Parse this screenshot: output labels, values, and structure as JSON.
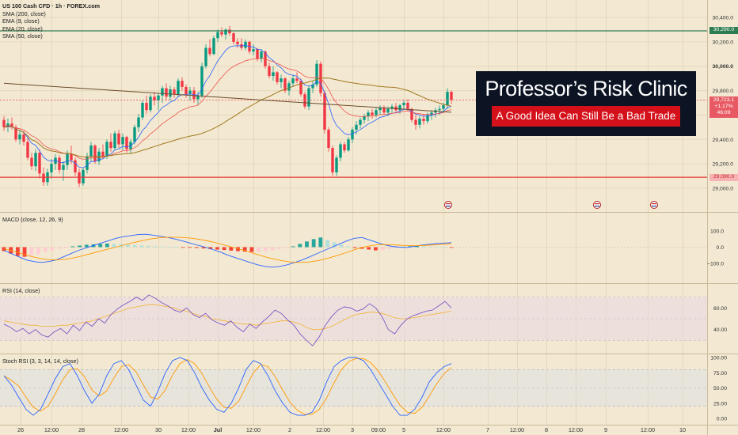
{
  "legend": {
    "title": "US 100 Cash CFD · 1h · FOREX.com",
    "sma200": "SMA (200, close)",
    "ema9": "EMA (9, close)",
    "ema20": "EMA (20, close)",
    "sma50": "SMA (50, close)"
  },
  "panes": {
    "macd_label": "MACD (close, 12, 26, 9)",
    "rsi_label": "RSI (14, close)",
    "stoch_label": "Stoch RSI (3, 3, 14, 14, close)"
  },
  "banner": {
    "title": "Professor’s Risk Clinic",
    "subtitle": "A Good Idea Can Still Be a Bad Trade"
  },
  "badges": {
    "resistance": "30,290.0",
    "price": "29,723.1",
    "change": "+1.17%",
    "countdown": "46:09",
    "support": "29,090.0"
  },
  "colors": {
    "background": "#f3e9d2",
    "up": "#089981",
    "down": "#f23645",
    "ema9": "#2962ff",
    "ema20": "#ef5350",
    "sma50": "#a0781e",
    "sma200": "#6d4c2b",
    "resistance": "#2e7d52",
    "support": "#e53935",
    "macd_signal": "#ff9800",
    "stoch_d": "#ff9800"
  },
  "chart_data": [
    {
      "type": "candlestick",
      "title": "US 100 Cash CFD · 1h · FOREX.com",
      "x_tick_labels": [
        "26",
        "12:00",
        "28",
        "12:00",
        "30",
        "12:00",
        "Jul",
        "12:00",
        "2",
        "12:00",
        "3",
        "09:00",
        "5",
        "12:00",
        "7",
        "12:00",
        "8",
        "12:00",
        "9",
        "12:00",
        "10"
      ],
      "y_tick_labels": [
        "29,000.0",
        "29,200.0",
        "29,400.0",
        "29,600.0",
        "29,800.0",
        "30,000.0",
        "30,200.0",
        "30,400.0"
      ],
      "ylim": [
        28980,
        30450
      ],
      "resistance": 30290,
      "support": 29090,
      "last_price": 29723.1,
      "change_pct": 1.17,
      "candles": [
        [
          29560,
          29590,
          29470,
          29500
        ],
        [
          29500,
          29570,
          29460,
          29530
        ],
        [
          29530,
          29580,
          29480,
          29500
        ],
        [
          29500,
          29520,
          29380,
          29400
        ],
        [
          29400,
          29470,
          29360,
          29440
        ],
        [
          29440,
          29470,
          29350,
          29380
        ],
        [
          29380,
          29420,
          29230,
          29250
        ],
        [
          29250,
          29290,
          29150,
          29180
        ],
        [
          29180,
          29320,
          29140,
          29290
        ],
        [
          29290,
          29320,
          29080,
          29120
        ],
        [
          29120,
          29170,
          29020,
          29050
        ],
        [
          29050,
          29160,
          29020,
          29130
        ],
        [
          29130,
          29240,
          29080,
          29200
        ],
        [
          29200,
          29280,
          29150,
          29250
        ],
        [
          29250,
          29270,
          29120,
          29150
        ],
        [
          29150,
          29220,
          29060,
          29190
        ],
        [
          29190,
          29310,
          29150,
          29280
        ],
        [
          29280,
          29350,
          29200,
          29230
        ],
        [
          29230,
          29250,
          29100,
          29130
        ],
        [
          29130,
          29160,
          29010,
          29040
        ],
        [
          29040,
          29170,
          29020,
          29150
        ],
        [
          29150,
          29290,
          29120,
          29260
        ],
        [
          29260,
          29380,
          29220,
          29350
        ],
        [
          29350,
          29360,
          29200,
          29220
        ],
        [
          29220,
          29330,
          29190,
          29300
        ],
        [
          29300,
          29360,
          29240,
          29260
        ],
        [
          29260,
          29400,
          29240,
          29380
        ],
        [
          29380,
          29450,
          29300,
          29330
        ],
        [
          29330,
          29470,
          29310,
          29450
        ],
        [
          29450,
          29480,
          29330,
          29360
        ],
        [
          29360,
          29450,
          29310,
          29420
        ],
        [
          29420,
          29430,
          29290,
          29320
        ],
        [
          29320,
          29400,
          29280,
          29380
        ],
        [
          29380,
          29520,
          29360,
          29500
        ],
        [
          29500,
          29610,
          29460,
          29580
        ],
        [
          29580,
          29720,
          29560,
          29700
        ],
        [
          29700,
          29760,
          29610,
          29640
        ],
        [
          29640,
          29770,
          29620,
          29750
        ],
        [
          29750,
          29790,
          29680,
          29720
        ],
        [
          29720,
          29780,
          29640,
          29760
        ],
        [
          29760,
          29840,
          29700,
          29820
        ],
        [
          29820,
          29860,
          29720,
          29750
        ],
        [
          29750,
          29840,
          29720,
          29810
        ],
        [
          29810,
          29830,
          29740,
          29770
        ],
        [
          29770,
          29900,
          29750,
          29880
        ],
        [
          29880,
          29910,
          29800,
          29830
        ],
        [
          29830,
          29850,
          29740,
          29770
        ],
        [
          29770,
          29830,
          29720,
          29800
        ],
        [
          29800,
          29830,
          29700,
          29730
        ],
        [
          29730,
          29790,
          29680,
          29760
        ],
        [
          29760,
          30030,
          29740,
          30000
        ],
        [
          30000,
          30180,
          29980,
          30150
        ],
        [
          30150,
          30220,
          30080,
          30100
        ],
        [
          30100,
          30250,
          30090,
          30230
        ],
        [
          30230,
          30300,
          30200,
          30280
        ],
        [
          30280,
          30320,
          30240,
          30260
        ],
        [
          30260,
          30310,
          30220,
          30300
        ],
        [
          30300,
          30330,
          30250,
          30270
        ],
        [
          30270,
          30280,
          30180,
          30200
        ],
        [
          30200,
          30230,
          30150,
          30180
        ],
        [
          30180,
          30230,
          30130,
          30150
        ],
        [
          30150,
          30220,
          30130,
          30200
        ],
        [
          30200,
          30210,
          30100,
          30120
        ],
        [
          30120,
          30180,
          30090,
          30140
        ],
        [
          30140,
          30150,
          30040,
          30060
        ],
        [
          30060,
          30140,
          30030,
          30120
        ],
        [
          30120,
          30130,
          29980,
          30000
        ],
        [
          30000,
          30030,
          29900,
          29920
        ],
        [
          29920,
          30000,
          29880,
          29950
        ],
        [
          29950,
          29960,
          29850,
          29870
        ],
        [
          29870,
          29930,
          29820,
          29900
        ],
        [
          29900,
          29910,
          29780,
          29800
        ],
        [
          29800,
          29880,
          29760,
          29860
        ],
        [
          29860,
          29930,
          29830,
          29900
        ],
        [
          29900,
          29950,
          29860,
          29880
        ],
        [
          29880,
          29900,
          29750,
          29770
        ],
        [
          29770,
          29790,
          29650,
          29670
        ],
        [
          29670,
          29840,
          29640,
          29820
        ],
        [
          29820,
          29880,
          29780,
          29850
        ],
        [
          29850,
          30050,
          29830,
          30020
        ],
        [
          30020,
          30040,
          29750,
          29780
        ],
        [
          29780,
          29800,
          29450,
          29480
        ],
        [
          29480,
          29500,
          29300,
          29330
        ],
        [
          29330,
          29350,
          29100,
          29130
        ],
        [
          29130,
          29270,
          29100,
          29250
        ],
        [
          29250,
          29380,
          29220,
          29360
        ],
        [
          29360,
          29380,
          29290,
          29310
        ],
        [
          29310,
          29420,
          29300,
          29400
        ],
        [
          29400,
          29500,
          29370,
          29480
        ],
        [
          29480,
          29550,
          29440,
          29520
        ],
        [
          29520,
          29580,
          29490,
          29560
        ],
        [
          29560,
          29610,
          29530,
          29590
        ],
        [
          29590,
          29640,
          29550,
          29620
        ],
        [
          29620,
          29650,
          29570,
          29600
        ],
        [
          29600,
          29660,
          29580,
          29640
        ],
        [
          29640,
          29680,
          29600,
          29660
        ],
        [
          29660,
          29680,
          29600,
          29620
        ],
        [
          29620,
          29670,
          29590,
          29650
        ],
        [
          29650,
          29690,
          29620,
          29670
        ],
        [
          29670,
          29700,
          29620,
          29640
        ],
        [
          29640,
          29690,
          29610,
          29680
        ],
        [
          29680,
          29720,
          29650,
          29700
        ],
        [
          29700,
          29730,
          29630,
          29650
        ],
        [
          29650,
          29660,
          29540,
          29560
        ],
        [
          29560,
          29600,
          29480,
          29520
        ],
        [
          29520,
          29590,
          29490,
          29570
        ],
        [
          29570,
          29610,
          29520,
          29550
        ],
        [
          29550,
          29620,
          29530,
          29600
        ],
        [
          29600,
          29640,
          29560,
          29620
        ],
        [
          29620,
          29660,
          29580,
          29640
        ],
        [
          29640,
          29680,
          29600,
          29650
        ],
        [
          29650,
          29700,
          29620,
          29680
        ],
        [
          29680,
          29820,
          29650,
          29790
        ],
        [
          29790,
          29800,
          29690,
          29723
        ]
      ]
    },
    {
      "type": "bar",
      "title": "MACD (close, 12, 26, 9)",
      "y_tick_labels": [
        "100.0",
        "0.0",
        "−100.0"
      ],
      "ylim": [
        -175,
        160
      ],
      "histogram": [
        -25,
        -40,
        -55,
        -60,
        -50,
        -45,
        -30,
        -20,
        -10,
        -5,
        5,
        10,
        15,
        18,
        20,
        22,
        20,
        18,
        15,
        12,
        10,
        8,
        6,
        4,
        2,
        1,
        -1,
        -3,
        -5,
        -8,
        -12,
        -15,
        -18,
        -22,
        -25,
        -28,
        -30,
        -28,
        -25,
        -20,
        -12,
        -6,
        5,
        20,
        35,
        50,
        60,
        45,
        30,
        15,
        5,
        -5,
        -10,
        -15,
        -20,
        -18,
        -12,
        -5,
        2,
        6,
        8,
        6,
        4,
        2,
        0,
        -2
      ],
      "macd": [
        -20,
        -40,
        -60,
        -80,
        -90,
        -95,
        -90,
        -80,
        -60,
        -40,
        -20,
        -5,
        10,
        25,
        40,
        55,
        65,
        72,
        78,
        80,
        75,
        68,
        60,
        50,
        38,
        25,
        12,
        0,
        -15,
        -30,
        -50,
        -65,
        -80,
        -95,
        -110,
        -120,
        -125,
        -120,
        -110,
        -95,
        -80,
        -60,
        -40,
        -20,
        0,
        20,
        40,
        55,
        60,
        45,
        30,
        15,
        5,
        0,
        -2,
        5,
        12,
        18,
        22,
        25,
        28
      ],
      "signal": [
        -10,
        -22,
        -35,
        -50,
        -62,
        -72,
        -78,
        -80,
        -77,
        -70,
        -60,
        -48,
        -36,
        -24,
        -12,
        0,
        12,
        24,
        35,
        45,
        53,
        59,
        62,
        62,
        60,
        56,
        50,
        42,
        32,
        20,
        8,
        -5,
        -18,
        -32,
        -46,
        -60,
        -72,
        -82,
        -90,
        -95,
        -95,
        -92,
        -85,
        -75,
        -62,
        -48,
        -32,
        -16,
        -2,
        8,
        14,
        16,
        15,
        12,
        10,
        9,
        10,
        12,
        15,
        18,
        22
      ]
    },
    {
      "type": "line",
      "title": "RSI (14, close)",
      "y_tick_labels": [
        "60.00",
        "40.00"
      ],
      "ylim": [
        20,
        80
      ],
      "rsi": [
        45,
        42,
        38,
        41,
        36,
        40,
        35,
        33,
        38,
        41,
        36,
        44,
        39,
        47,
        43,
        50,
        46,
        54,
        59,
        63,
        66,
        70,
        67,
        72,
        69,
        65,
        62,
        58,
        56,
        60,
        54,
        51,
        55,
        49,
        46,
        44,
        48,
        42,
        38,
        45,
        41,
        47,
        52,
        58,
        55,
        49,
        44,
        36,
        30,
        25,
        33,
        44,
        52,
        58,
        61,
        60,
        57,
        59,
        64,
        60,
        52,
        40,
        36,
        44,
        50,
        53,
        55,
        57,
        58,
        62,
        66,
        60
      ],
      "rsi_ma": [
        48,
        47,
        46,
        45,
        44,
        44,
        43,
        43,
        43,
        44,
        44,
        45,
        46,
        47,
        48,
        50,
        52,
        54,
        56,
        58,
        60,
        61,
        62,
        63,
        63,
        62,
        61,
        60,
        58,
        57,
        55,
        53,
        52,
        50,
        49,
        48,
        47,
        46,
        45,
        45,
        44,
        45,
        46,
        47,
        48,
        48,
        47,
        45,
        42,
        40,
        40,
        41,
        43,
        46,
        49,
        52,
        54,
        55,
        56,
        56,
        55,
        53,
        51,
        50,
        50,
        51,
        52,
        53,
        54,
        55,
        56,
        57
      ]
    },
    {
      "type": "line",
      "title": "Stoch RSI (3, 3, 14, 14, close)",
      "y_tick_labels": [
        "100.00",
        "75.00",
        "50.00",
        "25.00",
        "0.00"
      ],
      "ylim": [
        -5,
        105
      ],
      "k": [
        70,
        55,
        35,
        15,
        5,
        15,
        40,
        65,
        85,
        90,
        70,
        45,
        25,
        40,
        70,
        90,
        95,
        80,
        55,
        30,
        20,
        45,
        75,
        95,
        100,
        95,
        75,
        50,
        30,
        15,
        10,
        25,
        50,
        80,
        95,
        90,
        70,
        45,
        25,
        10,
        5,
        5,
        10,
        30,
        60,
        85,
        95,
        100,
        100,
        95,
        80,
        60,
        40,
        20,
        5,
        5,
        15,
        35,
        60,
        75,
        85,
        90
      ]
    }
  ]
}
